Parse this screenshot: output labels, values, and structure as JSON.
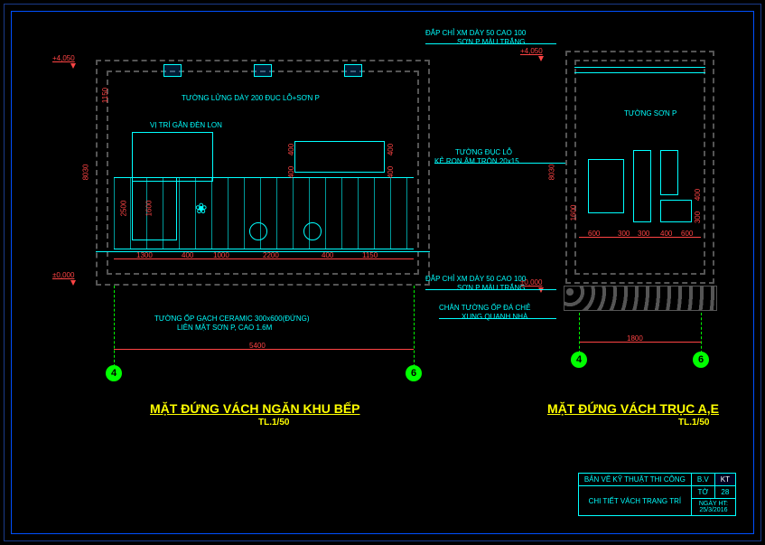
{
  "titles": {
    "left": "MẶT ĐỨNG VÁCH NGĂN KHU BẾP",
    "right": "MẶT ĐỨNG VÁCH TRỤC A,E",
    "scale": "TL.1/50"
  },
  "annotations": {
    "a1": "TƯỜNG LỬNG DÀY 200 ĐỤC LỖ+SƠN P",
    "a2": "VỊ TRÍ GẮN ĐÈN LON",
    "a3": "TƯỜNG ỐP GẠCH CERAMIC 300x600(ĐỨNG)",
    "a4": "LIÊN MẶT SƠN P, CAO 1.6M",
    "a5": "ĐẮP CHỈ XM DÀY 50 CAO 100",
    "a6": "SƠN P MÀU TRẮNG",
    "a7": "TƯỜNG SƠN P",
    "a8": "TƯỜNG ĐỤC LỖ",
    "a9": "KẺ RON ÂM TRÒN 20x15",
    "a10": "CHÂN TƯỜNG ỐP ĐÁ CHẺ",
    "a11": "XUNG QUANH NHÀ"
  },
  "elevations": {
    "top": "+4,050",
    "bot": "±0,000"
  },
  "dims_left": {
    "h_total": "8030",
    "h1": "1150",
    "h2": "2500",
    "h3": "1600",
    "w_total": "5400",
    "w1": "1300",
    "w2": "400",
    "w3": "1000",
    "w4": "2200",
    "w5": "400",
    "w6": "1150",
    "v400a": "400",
    "v400b": "400",
    "v400c": "400",
    "v400d": "400"
  },
  "dims_right": {
    "h_total": "8030",
    "h1": "1600",
    "h2": "400",
    "h3": "300",
    "w_total": "1800",
    "w1": "600",
    "w2": "300",
    "w3": "300",
    "w4": "400",
    "w5": "600"
  },
  "axes": {
    "a4": "4",
    "a6": "6"
  },
  "titleblock": {
    "r1": "BẢN VẼ KỸ THUẬT THI CÔNG",
    "r2a": "B.V",
    "r2b": "KT",
    "r3": "CHI TIẾT VÁCH TRANG TRÍ",
    "r3a": "TỜ",
    "r3b": "28",
    "r4a": "NGÀY HT:",
    "r4b": "25/3/2016"
  }
}
